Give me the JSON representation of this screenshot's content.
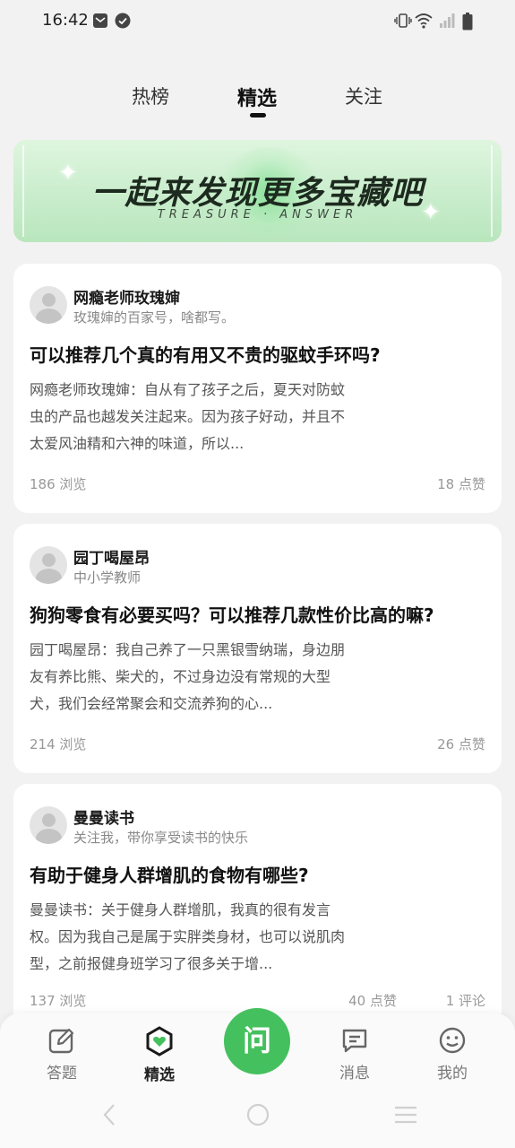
{
  "status_bar": {
    "time": "16:42",
    "left_icons": [
      "notification-icon",
      "check-circle-icon"
    ],
    "right_icons": [
      "vibrate-icon",
      "wifi-icon",
      "signal-icon",
      "battery-icon"
    ]
  },
  "top_tabs": [
    {
      "label": "热榜",
      "active": false
    },
    {
      "label": "精选",
      "active": true
    },
    {
      "label": "关注",
      "active": false
    }
  ],
  "banner": {
    "title": "一起来发现更多宝藏吧",
    "subtitle": "TREASURE · ANSWER"
  },
  "cards": [
    {
      "author": "网瘾老师玫瑰婶",
      "author_desc": "玫瑰婶的百家号，啥都写。",
      "title": "可以推荐几个真的有用又不贵的驱蚊手环吗?",
      "excerpt": "网瘾老师玫瑰婶：自从有了孩子之后，夏天对防蚊虫的产品也越发关注起来。因为孩子好动，并且不太爱风油精和六神的味道，所以...",
      "views": "186 浏览",
      "likes": "18 点赞",
      "comments": ""
    },
    {
      "author": "园丁喝屋昂",
      "author_desc": "中小学教师",
      "title": "狗狗零食有必要买吗？可以推荐几款性价比高的嘛?",
      "excerpt": "园丁喝屋昂：我自己养了一只黑银雪纳瑞，身边朋友有养比熊、柴犬的，不过身边没有常规的大型犬，我们会经常聚会和交流养狗的心...",
      "views": "214 浏览",
      "likes": "26 点赞",
      "comments": ""
    },
    {
      "author": "曼曼读书",
      "author_desc": "关注我，带你享受读书的快乐",
      "title": "有助于健身人群增肌的食物有哪些?",
      "excerpt": "曼曼读书：关于健身人群增肌，我真的很有发言权。因为我自己是属于实胖类身材，也可以说肌肉型，之前报健身班学习了很多关于增...",
      "views": "137 浏览",
      "likes": "40 点赞",
      "comments": "1 评论"
    }
  ],
  "bottom_nav": {
    "items": [
      {
        "label": "答题",
        "icon": "edit-icon",
        "active": false
      },
      {
        "label": "精选",
        "icon": "hexagon-heart-icon",
        "active": true
      },
      {
        "label": "消息",
        "icon": "message-icon",
        "active": false
      },
      {
        "label": "我的",
        "icon": "smile-face-icon",
        "active": false
      }
    ],
    "ask_label": "问"
  },
  "colors": {
    "accent": "#45c05e",
    "background": "#f2f2f2",
    "card": "#ffffff",
    "muted_text": "#999999"
  }
}
